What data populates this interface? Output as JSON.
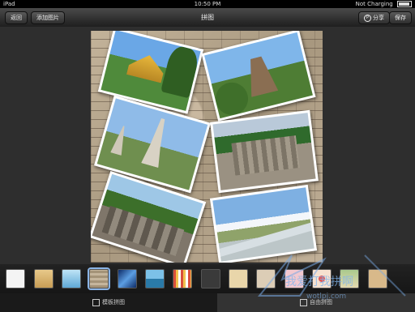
{
  "status_bar": {
    "device": "iPad",
    "time": "10:50 PM",
    "battery_text": "Not Charging",
    "battery_level": 0.9
  },
  "nav": {
    "back_label": "返回",
    "add_label": "添加图片",
    "title": "拼图",
    "share_label": "分享",
    "share_icon_text": "P",
    "save_label": "保存"
  },
  "tabs": {
    "template_label": "模板拼图",
    "free_label": "自由拼图"
  },
  "watermark": {
    "text": "我爱打我拼啊",
    "domain": "wotlpj.com"
  },
  "colors": {
    "accent": "#8ab4e6",
    "bar_dark": "#1e1e1e"
  },
  "photos": [
    "royal-palace-photo",
    "temple-ruin-photo",
    "stupa-photo",
    "bayon-ruins-photo",
    "overgrown-ruins-photo",
    "river-landscape-photo"
  ],
  "background_thumbs": [
    "white",
    "gold-sand",
    "light-blue",
    "stone-wall",
    "blue-gradient",
    "ocean",
    "stripes",
    "dark-leather",
    "cream",
    "beige-pattern",
    "pink-pattern",
    "floral",
    "vintage",
    "tan"
  ]
}
